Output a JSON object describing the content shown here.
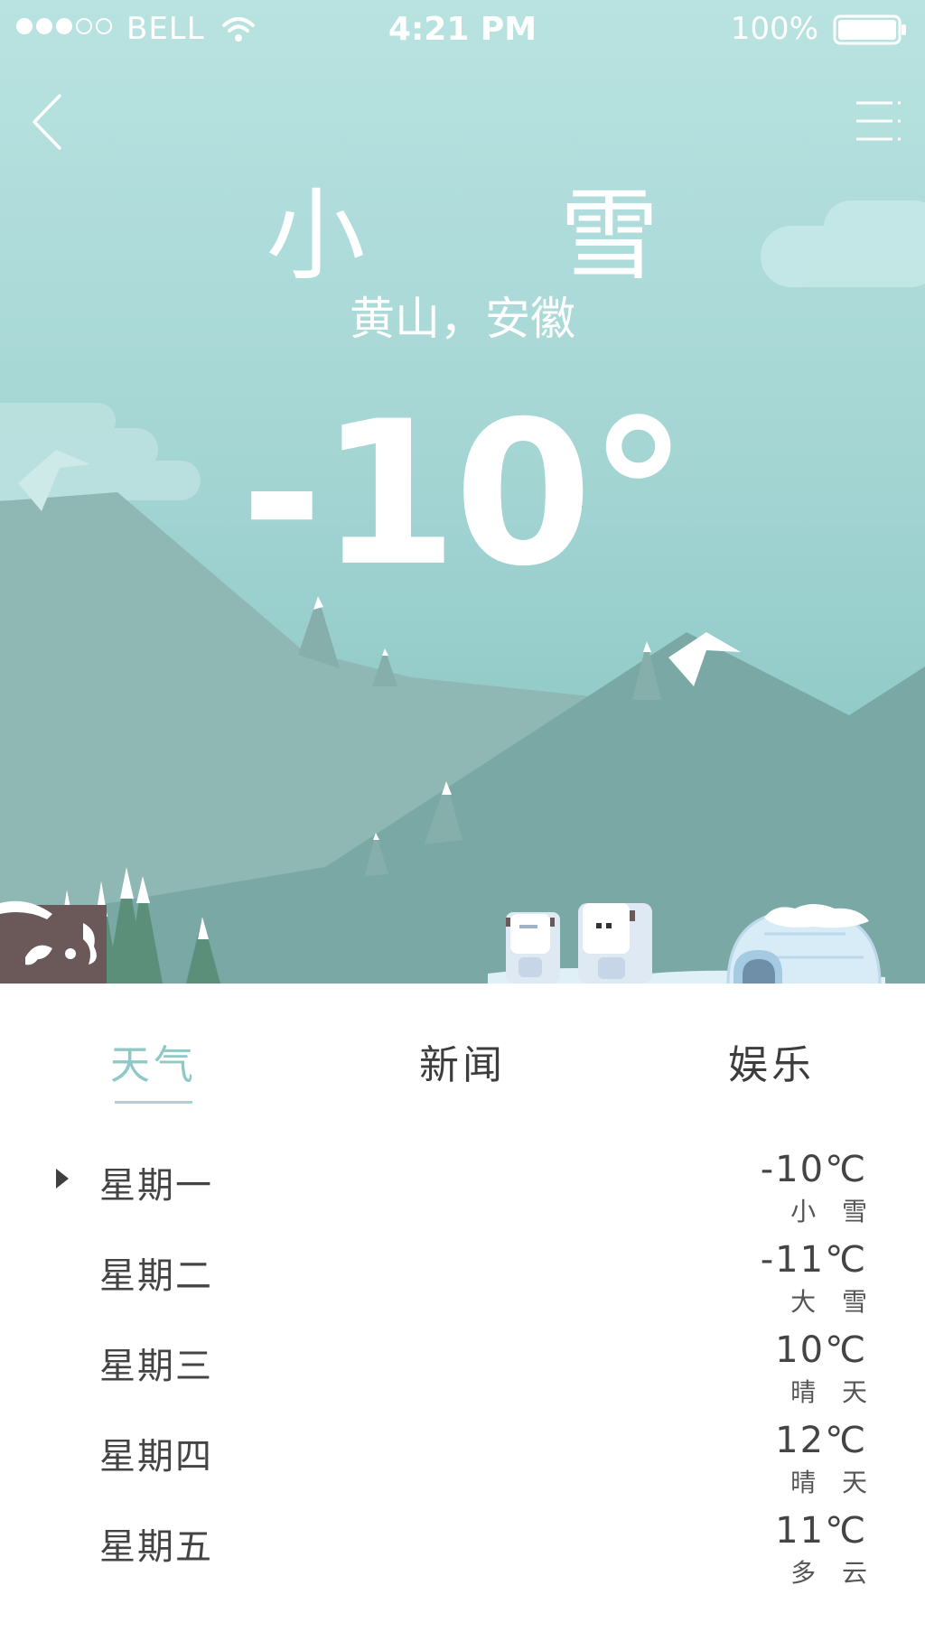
{
  "status_bar": {
    "carrier": "BELL",
    "time": "4:21 PM",
    "battery": "100%",
    "signal_bars_filled": 3,
    "signal_bars_total": 5
  },
  "header": {
    "back_icon": "chevron-left-icon",
    "menu_icon": "menu-icon"
  },
  "current": {
    "condition": "小 雪",
    "location": "黄山，安徽",
    "temperature": "-10°"
  },
  "tabs": [
    {
      "label": "天气",
      "active": true
    },
    {
      "label": "新闻",
      "active": false
    },
    {
      "label": "娱乐",
      "active": false
    }
  ],
  "forecast": [
    {
      "day": "星期一",
      "temp": "-10℃",
      "condition": "小 雪",
      "selected": true
    },
    {
      "day": "星期二",
      "temp": "-11℃",
      "condition": "大 雪",
      "selected": false
    },
    {
      "day": "星期三",
      "temp": "10℃",
      "condition": "晴 天",
      "selected": false
    },
    {
      "day": "星期四",
      "temp": "12℃",
      "condition": "晴 天",
      "selected": false
    },
    {
      "day": "星期五",
      "temp": "11℃",
      "condition": "多 云",
      "selected": false
    }
  ],
  "colors": {
    "sky_top": "#b8e2e0",
    "sky_bottom": "#8ec8c6",
    "mountain_back": "#8fb7b4",
    "mountain_front": "#7aa9a5",
    "tab_active": "#8fc8c6",
    "text_dark": "#444444"
  }
}
